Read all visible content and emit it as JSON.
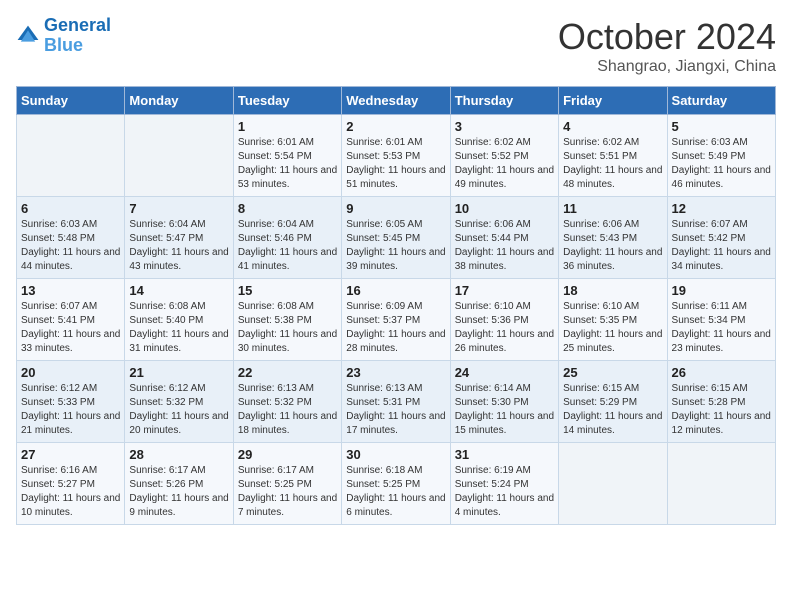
{
  "header": {
    "logo_line1": "General",
    "logo_line2": "Blue",
    "month": "October 2024",
    "location": "Shangrao, Jiangxi, China"
  },
  "weekdays": [
    "Sunday",
    "Monday",
    "Tuesday",
    "Wednesday",
    "Thursday",
    "Friday",
    "Saturday"
  ],
  "weeks": [
    [
      {
        "day": "",
        "info": ""
      },
      {
        "day": "",
        "info": ""
      },
      {
        "day": "1",
        "info": "Sunrise: 6:01 AM\nSunset: 5:54 PM\nDaylight: 11 hours and 53 minutes."
      },
      {
        "day": "2",
        "info": "Sunrise: 6:01 AM\nSunset: 5:53 PM\nDaylight: 11 hours and 51 minutes."
      },
      {
        "day": "3",
        "info": "Sunrise: 6:02 AM\nSunset: 5:52 PM\nDaylight: 11 hours and 49 minutes."
      },
      {
        "day": "4",
        "info": "Sunrise: 6:02 AM\nSunset: 5:51 PM\nDaylight: 11 hours and 48 minutes."
      },
      {
        "day": "5",
        "info": "Sunrise: 6:03 AM\nSunset: 5:49 PM\nDaylight: 11 hours and 46 minutes."
      }
    ],
    [
      {
        "day": "6",
        "info": "Sunrise: 6:03 AM\nSunset: 5:48 PM\nDaylight: 11 hours and 44 minutes."
      },
      {
        "day": "7",
        "info": "Sunrise: 6:04 AM\nSunset: 5:47 PM\nDaylight: 11 hours and 43 minutes."
      },
      {
        "day": "8",
        "info": "Sunrise: 6:04 AM\nSunset: 5:46 PM\nDaylight: 11 hours and 41 minutes."
      },
      {
        "day": "9",
        "info": "Sunrise: 6:05 AM\nSunset: 5:45 PM\nDaylight: 11 hours and 39 minutes."
      },
      {
        "day": "10",
        "info": "Sunrise: 6:06 AM\nSunset: 5:44 PM\nDaylight: 11 hours and 38 minutes."
      },
      {
        "day": "11",
        "info": "Sunrise: 6:06 AM\nSunset: 5:43 PM\nDaylight: 11 hours and 36 minutes."
      },
      {
        "day": "12",
        "info": "Sunrise: 6:07 AM\nSunset: 5:42 PM\nDaylight: 11 hours and 34 minutes."
      }
    ],
    [
      {
        "day": "13",
        "info": "Sunrise: 6:07 AM\nSunset: 5:41 PM\nDaylight: 11 hours and 33 minutes."
      },
      {
        "day": "14",
        "info": "Sunrise: 6:08 AM\nSunset: 5:40 PM\nDaylight: 11 hours and 31 minutes."
      },
      {
        "day": "15",
        "info": "Sunrise: 6:08 AM\nSunset: 5:38 PM\nDaylight: 11 hours and 30 minutes."
      },
      {
        "day": "16",
        "info": "Sunrise: 6:09 AM\nSunset: 5:37 PM\nDaylight: 11 hours and 28 minutes."
      },
      {
        "day": "17",
        "info": "Sunrise: 6:10 AM\nSunset: 5:36 PM\nDaylight: 11 hours and 26 minutes."
      },
      {
        "day": "18",
        "info": "Sunrise: 6:10 AM\nSunset: 5:35 PM\nDaylight: 11 hours and 25 minutes."
      },
      {
        "day": "19",
        "info": "Sunrise: 6:11 AM\nSunset: 5:34 PM\nDaylight: 11 hours and 23 minutes."
      }
    ],
    [
      {
        "day": "20",
        "info": "Sunrise: 6:12 AM\nSunset: 5:33 PM\nDaylight: 11 hours and 21 minutes."
      },
      {
        "day": "21",
        "info": "Sunrise: 6:12 AM\nSunset: 5:32 PM\nDaylight: 11 hours and 20 minutes."
      },
      {
        "day": "22",
        "info": "Sunrise: 6:13 AM\nSunset: 5:32 PM\nDaylight: 11 hours and 18 minutes."
      },
      {
        "day": "23",
        "info": "Sunrise: 6:13 AM\nSunset: 5:31 PM\nDaylight: 11 hours and 17 minutes."
      },
      {
        "day": "24",
        "info": "Sunrise: 6:14 AM\nSunset: 5:30 PM\nDaylight: 11 hours and 15 minutes."
      },
      {
        "day": "25",
        "info": "Sunrise: 6:15 AM\nSunset: 5:29 PM\nDaylight: 11 hours and 14 minutes."
      },
      {
        "day": "26",
        "info": "Sunrise: 6:15 AM\nSunset: 5:28 PM\nDaylight: 11 hours and 12 minutes."
      }
    ],
    [
      {
        "day": "27",
        "info": "Sunrise: 6:16 AM\nSunset: 5:27 PM\nDaylight: 11 hours and 10 minutes."
      },
      {
        "day": "28",
        "info": "Sunrise: 6:17 AM\nSunset: 5:26 PM\nDaylight: 11 hours and 9 minutes."
      },
      {
        "day": "29",
        "info": "Sunrise: 6:17 AM\nSunset: 5:25 PM\nDaylight: 11 hours and 7 minutes."
      },
      {
        "day": "30",
        "info": "Sunrise: 6:18 AM\nSunset: 5:25 PM\nDaylight: 11 hours and 6 minutes."
      },
      {
        "day": "31",
        "info": "Sunrise: 6:19 AM\nSunset: 5:24 PM\nDaylight: 11 hours and 4 minutes."
      },
      {
        "day": "",
        "info": ""
      },
      {
        "day": "",
        "info": ""
      }
    ]
  ]
}
